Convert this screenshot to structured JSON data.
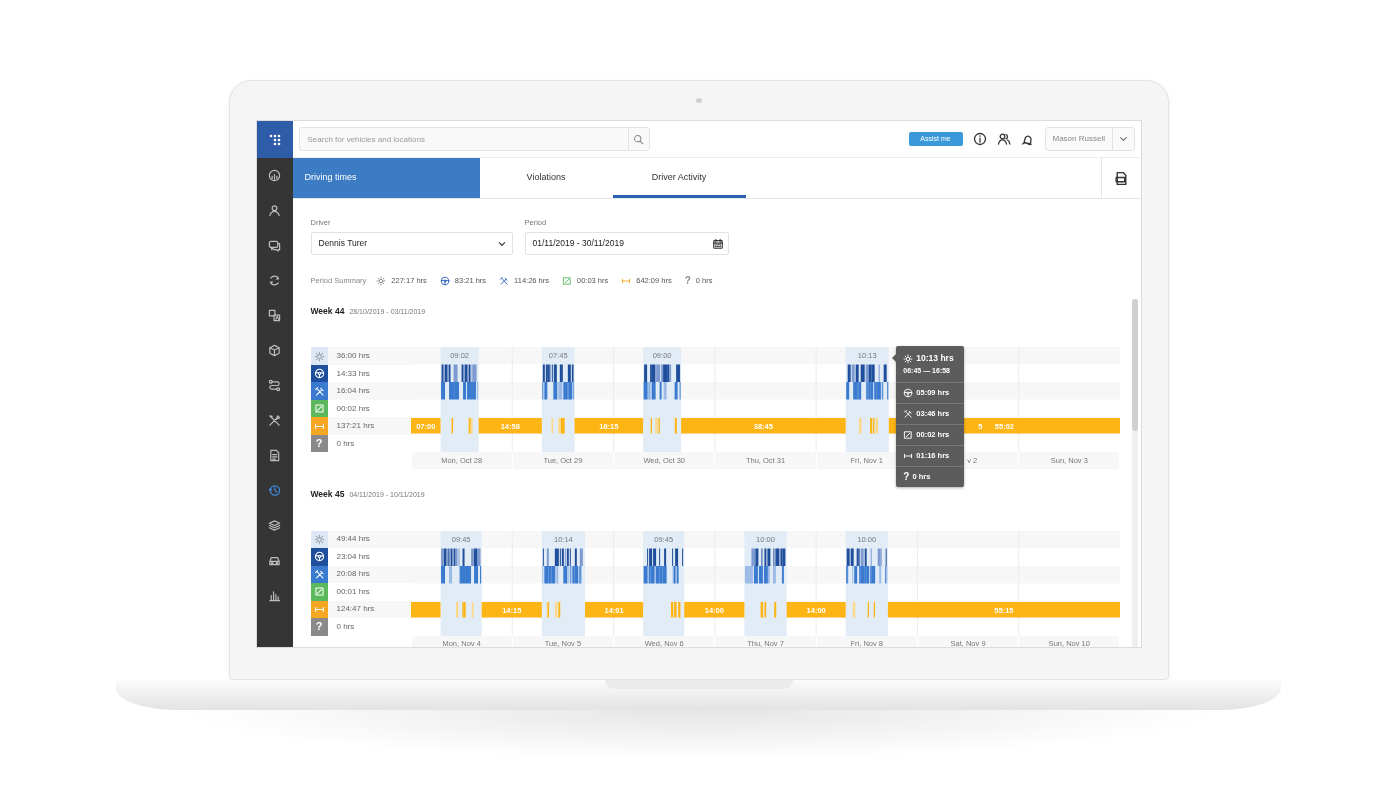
{
  "sidebar": {
    "items": [
      {
        "selected": false
      },
      {
        "selected": false
      },
      {
        "selected": false
      },
      {
        "selected": false
      },
      {
        "selected": false
      },
      {
        "selected": false
      },
      {
        "selected": false
      },
      {
        "selected": false
      },
      {
        "selected": false
      },
      {
        "selected": true
      },
      {
        "selected": false
      },
      {
        "selected": false
      },
      {
        "selected": false
      }
    ]
  },
  "search": {
    "placeholder": "Search for vehicles and locations"
  },
  "assist_button": "Assist me",
  "user_menu": {
    "name": "Mason Russell"
  },
  "page_title": "Driving times",
  "tabs": [
    {
      "label": "Violations",
      "selected": false
    },
    {
      "label": "Driver Activity",
      "selected": true
    }
  ],
  "filters": {
    "driver": {
      "label": "Driver",
      "value": "Dennis Turer"
    },
    "period": {
      "label": "Period",
      "value": "01/11/2019 - 30/11/2019"
    }
  },
  "period_summary": {
    "label": "Period Summary",
    "items": [
      {
        "kind": "shift",
        "value": "227:17 hrs"
      },
      {
        "kind": "driving",
        "value": "83:21 hrs"
      },
      {
        "kind": "work",
        "value": "114:26 hrs"
      },
      {
        "kind": "available",
        "value": "00:03 hrs"
      },
      {
        "kind": "rest",
        "value": "642:09 hrs"
      },
      {
        "kind": "unknown",
        "icon": "?",
        "value": "0 hrs"
      }
    ]
  },
  "weeks": [
    {
      "title": "Week 44",
      "range": "28/10/2019 - 03/11/2019",
      "rows": [
        {
          "kind": "shift",
          "total": "36:00 hrs"
        },
        {
          "kind": "driving",
          "total": "14:33 hrs"
        },
        {
          "kind": "work",
          "total": "16:04 hrs"
        },
        {
          "kind": "available",
          "total": "00:02 hrs"
        },
        {
          "kind": "rest",
          "total": "137:21 hrs"
        },
        {
          "kind": "unknown",
          "icon": "?",
          "total": "0 hrs"
        }
      ],
      "days": [
        {
          "label": "Mon, Oct 28",
          "shift": "09:02",
          "rest_before": [
            "07:00"
          ]
        },
        {
          "label": "Tue, Oct 29",
          "shift": "07:45",
          "rest_before": [
            "14:58"
          ]
        },
        {
          "label": "Wed, Oct 30",
          "shift": "09:00",
          "rest_before": [
            "16:15"
          ]
        },
        {
          "label": "Thu, Oct 31"
        },
        {
          "label": "Fri, Nov 1",
          "shift": "10:13",
          "rest_before": [
            "38:45"
          ],
          "tooltip": {
            "title": "10:13 hrs",
            "time_range": "06:45 — 16:58",
            "items": [
              {
                "kind": "driving",
                "value": "05:09 hrs"
              },
              {
                "kind": "work",
                "value": "03:46 hrs"
              },
              {
                "kind": "available",
                "value": "00:02 hrs"
              },
              {
                "kind": "rest",
                "value": "01:16 hrs"
              },
              {
                "kind": "unknown",
                "icon": "?",
                "value": "0 hrs"
              }
            ]
          }
        },
        {
          "label": "v 2"
        },
        {
          "label": "Sun, Nov 3"
        }
      ],
      "rest_after": [
        "5",
        "55:02"
      ]
    },
    {
      "title": "Week 45",
      "range": "04/11/2019 - 10/11/2019",
      "rows": [
        {
          "kind": "shift",
          "total": "49:44 hrs"
        },
        {
          "kind": "driving",
          "total": "23:04 hrs"
        },
        {
          "kind": "work",
          "total": "20:08 hrs"
        },
        {
          "kind": "available",
          "total": "00:01 hrs"
        },
        {
          "kind": "rest",
          "total": "124:47 hrs"
        },
        {
          "kind": "unknown",
          "icon": "?",
          "total": "0 hrs"
        }
      ],
      "days": [
        {
          "label": "Mon, Nov 4",
          "shift": "09:45"
        },
        {
          "label": "Tue, Nov 5",
          "shift": "10:14",
          "rest_before": [
            "14:15"
          ]
        },
        {
          "label": "Wed, Nov 6",
          "shift": "09:45",
          "rest_before": [
            "14:01"
          ]
        },
        {
          "label": "Thu, Nov 7",
          "shift": "10:00",
          "rest_before": [
            "14:00"
          ]
        },
        {
          "label": "Fri, Nov 8",
          "shift": "10:00",
          "rest_before": [
            "14:00"
          ]
        },
        {
          "label": "Sat, Nov 9"
        },
        {
          "label": "Sun, Nov 10"
        }
      ],
      "rest_after": [
        "55:15"
      ]
    }
  ]
}
